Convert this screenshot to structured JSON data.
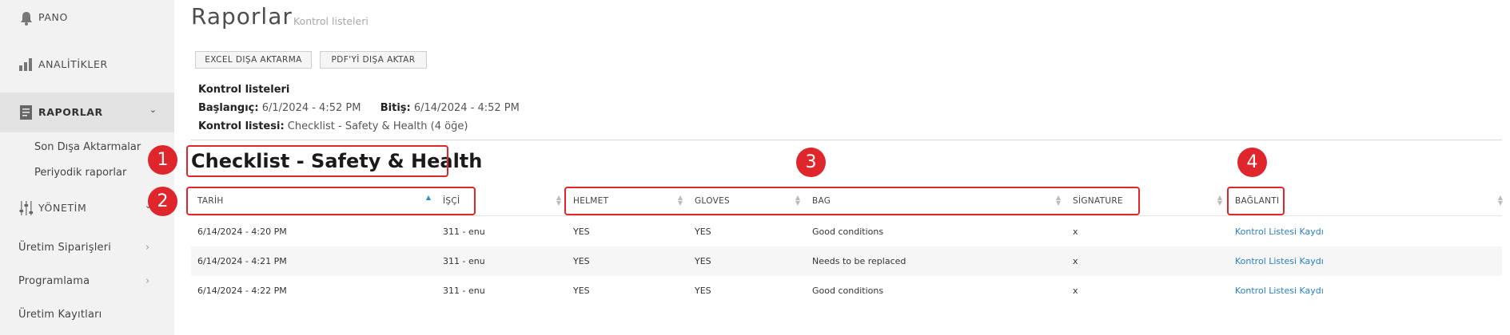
{
  "sidebar": {
    "pano": "PANO",
    "analitikler": "ANALİTİKLER",
    "raporlar": "RAPORLAR",
    "sub_items": [
      "Son Dışa Aktarmalar",
      "Periyodik raporlar"
    ],
    "yonetim": "YÖNETİM",
    "plain_items": [
      "Üretim Siparişleri",
      "Programlama",
      "Üretim Kayıtları"
    ]
  },
  "header": {
    "title": "Raporlar",
    "subtitle": "Kontrol listeleri"
  },
  "buttons": {
    "excel": "EXCEL DIŞA AKTARMA",
    "pdf": "PDF'Yİ DIŞA AKTAR"
  },
  "info": {
    "heading": "Kontrol listeleri",
    "start_label": "Başlangıç:",
    "start_value": "6/1/2024 - 4:52 PM",
    "end_label": "Bitiş:",
    "end_value": "6/14/2024 - 4:52 PM",
    "checklist_label": "Kontrol listesi:",
    "checklist_value": "Checklist - Safety & Health (4 öğe)"
  },
  "checklist_title": "Checklist - Safety & Health",
  "table": {
    "columns": [
      "TARİH",
      "İŞÇİ",
      "HELMET",
      "GLOVES",
      "BAG",
      "SİGNATURE",
      "BAĞLANTI"
    ],
    "rows": [
      [
        "6/14/2024 - 4:20 PM",
        "311 - enu",
        "YES",
        "YES",
        "Good conditions",
        "x",
        "Kontrol Listesi Kaydı"
      ],
      [
        "6/14/2024 - 4:21 PM",
        "311 - enu",
        "YES",
        "YES",
        "Needs to be replaced",
        "x",
        "Kontrol Listesi Kaydı"
      ],
      [
        "6/14/2024 - 4:22 PM",
        "311 - enu",
        "YES",
        "YES",
        "Good conditions",
        "x",
        "Kontrol Listesi Kaydı"
      ]
    ]
  },
  "annotations": [
    "1",
    "2",
    "3",
    "4"
  ],
  "colors": {
    "sidebar_bg": "#f2f2f2",
    "link": "#2a7fc1",
    "annotation": "#e0262d"
  }
}
